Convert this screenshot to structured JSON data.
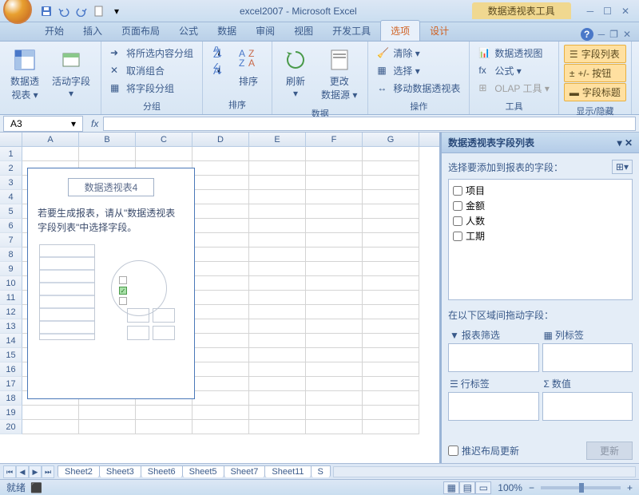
{
  "title": "excel2007 - Microsoft Excel",
  "context_tool_label": "数据透视表工具",
  "tabs": [
    "开始",
    "插入",
    "页面布局",
    "公式",
    "数据",
    "审阅",
    "视图",
    "开发工具",
    "选项",
    "设计"
  ],
  "active_tab_index": 8,
  "ribbon": {
    "group1": {
      "label": "",
      "pivot_table": "数据透\n视表 ▾",
      "active_field": "活动字段\n▾"
    },
    "group2": {
      "label": "分组",
      "group_sel": "将所选内容分组",
      "ungroup": "取消组合",
      "group_field": "将字段分组"
    },
    "group3": {
      "label": "排序",
      "sort": "排序"
    },
    "group4": {
      "label": "数据",
      "refresh": "刷新\n▾",
      "change_src": "更改\n数据源 ▾"
    },
    "group5": {
      "label": "操作",
      "clear": "清除 ▾",
      "select": "选择 ▾",
      "move": "移动数据透视表"
    },
    "group6": {
      "label": "工具",
      "chart": "数据透视图",
      "formula": "公式 ▾",
      "olap": "OLAP 工具 ▾"
    },
    "group7": {
      "label": "显示/隐藏",
      "field_list": "字段列表",
      "buttons": "+/- 按钮",
      "headers": "字段标题"
    }
  },
  "name_box": "A3",
  "columns": [
    "A",
    "B",
    "C",
    "D",
    "E",
    "F",
    "G"
  ],
  "row_count": 20,
  "pivot_placeholder": {
    "title": "数据透视表4",
    "help": "若要生成报表，请从\"数据透视表字段列表\"中选择字段。"
  },
  "field_pane": {
    "title": "数据透视表字段列表",
    "choose_label": "选择要添加到报表的字段：",
    "fields": [
      "项目",
      "金额",
      "人数",
      "工期"
    ],
    "drag_label": "在以下区域间拖动字段：",
    "areas": {
      "filter": "报表筛选",
      "column": "列标签",
      "row": "行标签",
      "value": "数值"
    },
    "defer": "推迟布局更新",
    "update": "更新"
  },
  "sheet_tabs": [
    "Sheet2",
    "Sheet3",
    "Sheet6",
    "Sheet5",
    "Sheet7",
    "Sheet11",
    "S"
  ],
  "status": {
    "ready": "就绪",
    "zoom": "100%"
  }
}
